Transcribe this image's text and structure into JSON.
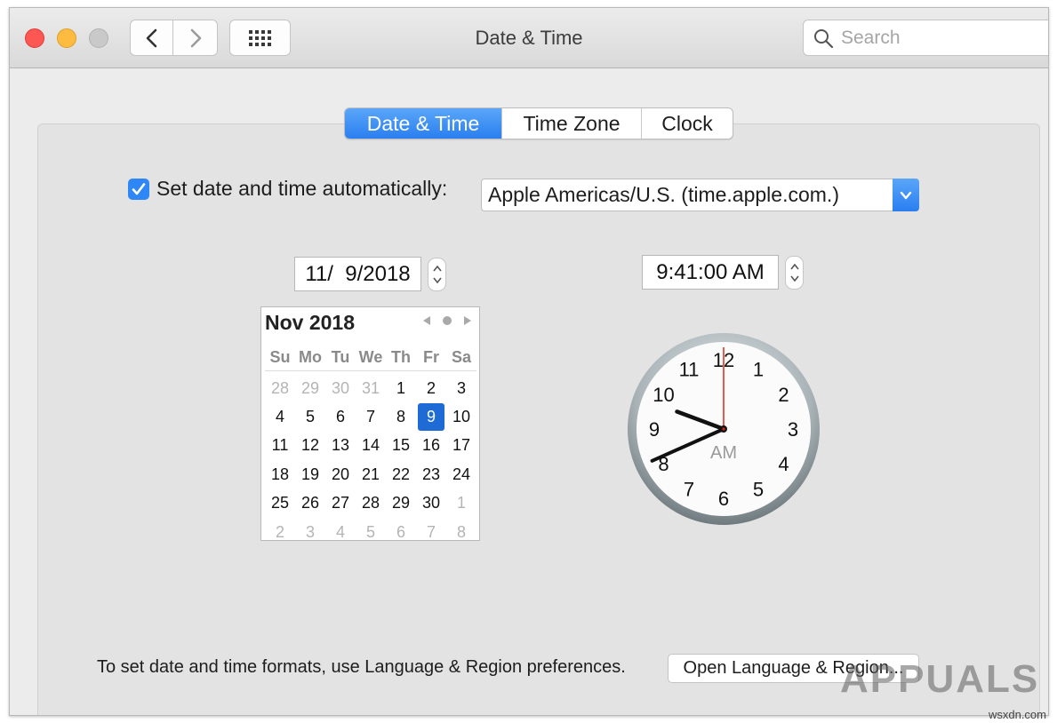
{
  "window": {
    "title": "Date & Time"
  },
  "search": {
    "placeholder": "Search"
  },
  "toolbar": {
    "back_icon": "chevron-left-icon",
    "forward_icon": "chevron-right-icon",
    "show_all_icon": "grid-icon"
  },
  "tabs": [
    {
      "label": "Date & Time",
      "active": true
    },
    {
      "label": "Time Zone",
      "active": false
    },
    {
      "label": "Clock",
      "active": false
    }
  ],
  "auto": {
    "checked": true,
    "label": "Set date and time automatically:",
    "server": "Apple Americas/U.S. (time.apple.com.)"
  },
  "date_field": {
    "value": "11/  9/2018"
  },
  "time_field": {
    "value": "9:41:00 AM"
  },
  "calendar": {
    "month": "Nov 2018",
    "weekdays": [
      "Su",
      "Mo",
      "Tu",
      "We",
      "Th",
      "Fr",
      "Sa"
    ],
    "days": [
      [
        "28",
        "m"
      ],
      [
        "29",
        "m"
      ],
      [
        "30",
        "m"
      ],
      [
        "31",
        "m"
      ],
      [
        "1",
        ""
      ],
      [
        "2",
        ""
      ],
      [
        "3",
        ""
      ],
      [
        "4",
        ""
      ],
      [
        "5",
        ""
      ],
      [
        "6",
        ""
      ],
      [
        "7",
        ""
      ],
      [
        "8",
        ""
      ],
      [
        "9",
        "s"
      ],
      [
        "10",
        ""
      ],
      [
        "11",
        ""
      ],
      [
        "12",
        ""
      ],
      [
        "13",
        ""
      ],
      [
        "14",
        ""
      ],
      [
        "15",
        ""
      ],
      [
        "16",
        ""
      ],
      [
        "17",
        ""
      ],
      [
        "18",
        ""
      ],
      [
        "19",
        ""
      ],
      [
        "20",
        ""
      ],
      [
        "21",
        ""
      ],
      [
        "22",
        ""
      ],
      [
        "23",
        ""
      ],
      [
        "24",
        ""
      ],
      [
        "25",
        ""
      ],
      [
        "26",
        ""
      ],
      [
        "27",
        ""
      ],
      [
        "28",
        ""
      ],
      [
        "29",
        ""
      ],
      [
        "30",
        ""
      ],
      [
        "1",
        "m"
      ],
      [
        "2",
        "m"
      ],
      [
        "3",
        "m"
      ],
      [
        "4",
        "m"
      ],
      [
        "5",
        "m"
      ],
      [
        "6",
        "m"
      ],
      [
        "7",
        "m"
      ],
      [
        "8",
        "m"
      ]
    ]
  },
  "clock": {
    "numbers": [
      "12",
      "1",
      "2",
      "3",
      "4",
      "5",
      "6",
      "7",
      "8",
      "9",
      "10",
      "11"
    ],
    "period": "AM",
    "hour": 9,
    "minute": 41,
    "second": 0
  },
  "footer": {
    "hint": "To set date and time formats, use Language & Region preferences.",
    "button": "Open Language & Region..."
  },
  "watermark": {
    "text": "APPUALS",
    "site": "wsxdn.com"
  },
  "colors": {
    "accent": "#2a7ff0",
    "close": "#fc5753",
    "minimize": "#fdbc40",
    "second_hand": "#d9261c"
  }
}
